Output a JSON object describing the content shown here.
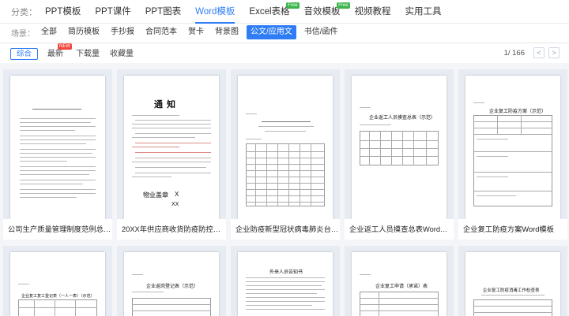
{
  "categories": {
    "label": "分类：",
    "items": [
      {
        "label": "PPT模板",
        "active": false,
        "free": ""
      },
      {
        "label": "PPT课件",
        "active": false,
        "free": ""
      },
      {
        "label": "PPT图表",
        "active": false,
        "free": ""
      },
      {
        "label": "Word模板",
        "active": true,
        "free": ""
      },
      {
        "label": "Excel表格",
        "active": false,
        "free": "Free"
      },
      {
        "label": "音效模板",
        "active": false,
        "free": "Free"
      },
      {
        "label": "视频教程",
        "active": false,
        "free": ""
      },
      {
        "label": "实用工具",
        "active": false,
        "free": ""
      }
    ]
  },
  "scenes": {
    "label": "场景：",
    "items": [
      {
        "label": "全部",
        "active": false
      },
      {
        "label": "简历模板",
        "active": false
      },
      {
        "label": "手抄报",
        "active": false
      },
      {
        "label": "合同范本",
        "active": false
      },
      {
        "label": "贺卡",
        "active": false
      },
      {
        "label": "背景图",
        "active": false
      },
      {
        "label": "公文/应用文",
        "active": true
      },
      {
        "label": "书信/函件",
        "active": false
      }
    ]
  },
  "sort": {
    "active_label": "综合",
    "latest_label": "最新",
    "new_badge": "NEW",
    "downloads_label": "下载量",
    "favorites_label": "收藏量"
  },
  "pager": {
    "text": "1/ 166",
    "prev": "<",
    "next": ">"
  },
  "cards": [
    {
      "title": "公司生产质量管理制度范例总则Word..."
    },
    {
      "title": "20XX年供应商收货防疫防控管理通知...",
      "thumb_heading": "通    知",
      "thumb_sign": "物业盖章",
      "thumb_x": "X",
      "thumb_date": "XX"
    },
    {
      "title": "企业防疫新型冠状病毒肺炎台账表格..."
    },
    {
      "title": "企业返工人员摸查总表Word模板",
      "thumb_heading": "企业返工人员摸查总表（示范）"
    },
    {
      "title": "企业复工防疫方案Word模板",
      "thumb_heading": "企业复工防疫方案（示范）"
    },
    {
      "title": "",
      "thumb_heading": "企业复工复工登记表（一人一表）（示范）"
    },
    {
      "title": "",
      "thumb_heading": "企业返岗登记表（示范）"
    },
    {
      "title": "",
      "thumb_heading": "外来人员告知书"
    },
    {
      "title": "",
      "thumb_heading": "企业复工申请（承诺）表"
    },
    {
      "title": "",
      "thumb_heading": "企业复工防疫消毒工作检查表"
    }
  ],
  "colors": {
    "accent": "#2f7df6",
    "free_badge": "#3cb44b",
    "new_badge": "#f0463c",
    "grid_bg": "#f3f5f9",
    "thumb_bg": "#e7ebf2"
  }
}
